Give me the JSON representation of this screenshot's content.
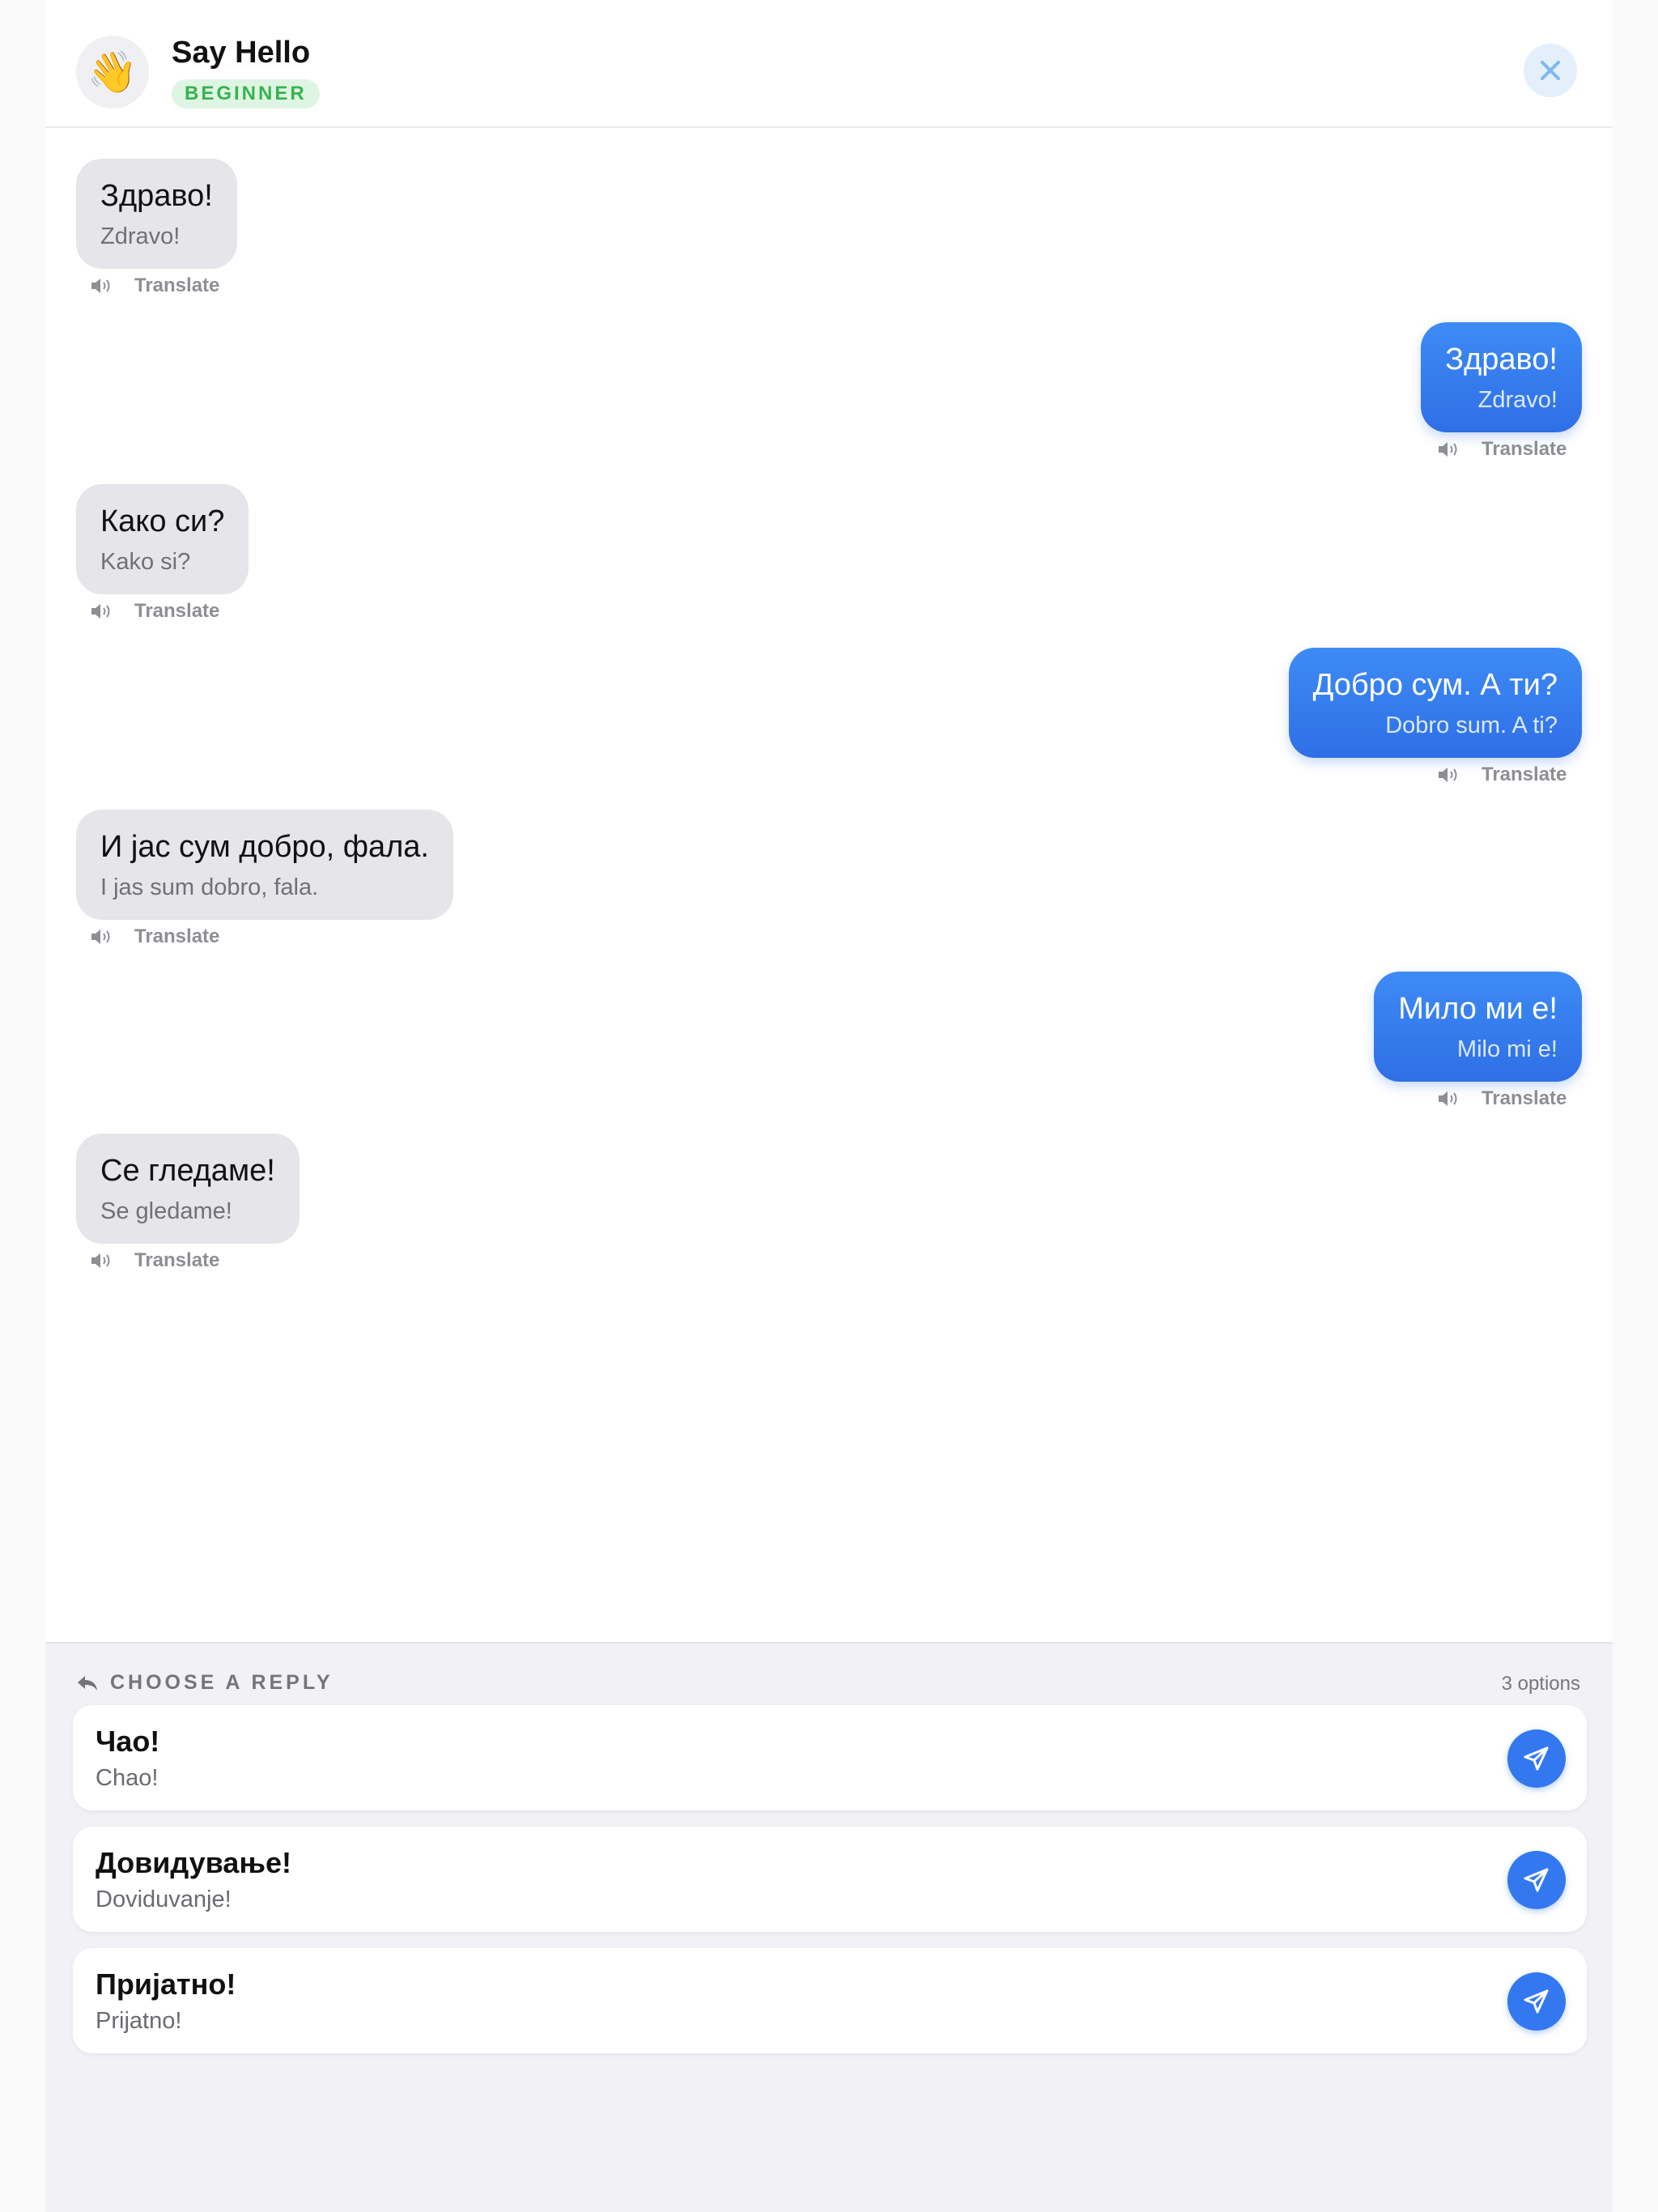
{
  "header": {
    "avatar_emoji": "👋",
    "title": "Say Hello",
    "level": "BEGINNER",
    "close_icon": "close-icon"
  },
  "messages": [
    {
      "sender": "bot",
      "text": "Здраво!",
      "transliteration": "Zdravo!",
      "translate_label": "Translate"
    },
    {
      "sender": "user",
      "text": "Здраво!",
      "transliteration": "Zdravo!",
      "translate_label": "Translate"
    },
    {
      "sender": "bot",
      "text": "Како си?",
      "transliteration": "Kako si?",
      "translate_label": "Translate"
    },
    {
      "sender": "user",
      "text": "Добро сум. А ти?",
      "transliteration": "Dobro sum. A ti?",
      "translate_label": "Translate"
    },
    {
      "sender": "bot",
      "text": "И јас сум добро, фала.",
      "transliteration": "I jas sum dobro, fala.",
      "translate_label": "Translate"
    },
    {
      "sender": "user",
      "text": "Мило ми е!",
      "transliteration": "Milo mi e!",
      "translate_label": "Translate"
    },
    {
      "sender": "bot",
      "text": "Се гледаме!",
      "transliteration": "Se gledame!",
      "translate_label": "Translate"
    }
  ],
  "reply": {
    "title": "CHOOSE A REPLY",
    "count": "3 options",
    "options": [
      {
        "text": "Чао!",
        "transliteration": "Chao!"
      },
      {
        "text": "Довидување!",
        "transliteration": "Doviduvanje!"
      },
      {
        "text": "Пријатно!",
        "transliteration": "Prijatno!"
      }
    ]
  },
  "colors": {
    "accent": "#3478f0",
    "bot_bubble": "#e5e5ea",
    "level_badge_bg": "#dff5e3",
    "level_badge_text": "#37b34f"
  }
}
